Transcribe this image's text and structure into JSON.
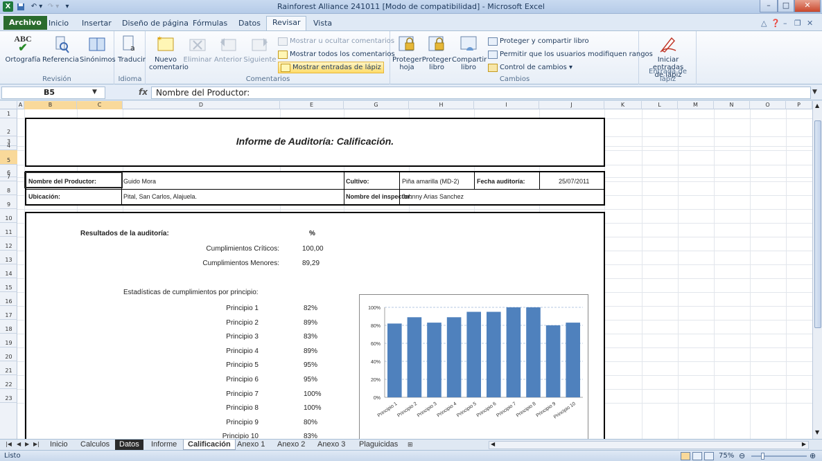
{
  "window": {
    "title": "Rainforest Alliance 241011  [Modo de compatibilidad]  -  Microsoft Excel",
    "app_icon": "X"
  },
  "menu": {
    "tabs": [
      "Archivo",
      "Inicio",
      "Insertar",
      "Diseño de página",
      "Fórmulas",
      "Datos",
      "Revisar",
      "Vista"
    ],
    "active": "Revisar"
  },
  "ribbon": {
    "revision": {
      "label": "Revisión",
      "ortografia": "Ortografía",
      "referencia": "Referencia",
      "sinonimos": "Sinónimos",
      "abc": "ABC"
    },
    "idioma": {
      "label": "Idioma",
      "traducir": "Traducir"
    },
    "comentarios": {
      "label": "Comentarios",
      "nuevo_1": "Nuevo",
      "nuevo_2": "comentario",
      "eliminar": "Eliminar",
      "anterior": "Anterior",
      "siguiente": "Siguiente",
      "mostrar_ocultar": "Mostrar u ocultar comentarios",
      "mostrar_todos": "Mostrar todos los comentarios",
      "mostrar_lapiz": "Mostrar entradas de lápiz"
    },
    "cambios": {
      "label": "Cambios",
      "proteger_hoja_1": "Proteger",
      "proteger_hoja_2": "hoja",
      "proteger_libro_1": "Proteger",
      "proteger_libro_2": "libro",
      "compartir_1": "Compartir",
      "compartir_2": "libro",
      "proteger_compartir": "Proteger y compartir libro",
      "permitir": "Permitir que los usuarios modifiquen rangos",
      "control": "Control de cambios ▾"
    },
    "lapiz": {
      "label": "Entrada de lápiz",
      "iniciar_1": "Iniciar entradas",
      "iniciar_2": "de lápiz"
    }
  },
  "formula_bar": {
    "name_box": "B5",
    "fx": "fx",
    "formula": "Nombre del Productor:"
  },
  "columns": [
    "A",
    "B",
    "C",
    "D",
    "E",
    "G",
    "H",
    "I",
    "J",
    "K",
    "L",
    "M",
    "N",
    "O",
    "P"
  ],
  "rows": [
    "1",
    "2",
    "3",
    "4",
    "5",
    "6",
    "7",
    "8",
    "9",
    "10",
    "11",
    "12",
    "13",
    "14",
    "15",
    "16",
    "17",
    "18",
    "19",
    "20",
    "21",
    "22",
    "23"
  ],
  "sheet": {
    "report_title": "Informe de Auditoría: Calificación.",
    "info": {
      "productor_label": "Nombre del Productor:",
      "productor_value": "Guido Mora",
      "cultivo_label": "Cultivo:",
      "cultivo_value": "Piña amarilla (MD-2)",
      "fecha_label": "Fecha auditoría:",
      "fecha_value": "25/07/2011",
      "ubicacion_label": "Ubicación:",
      "ubicacion_value": "Pital, San Carlos, Alajuela.",
      "inspector_label": "Nombre del inspector:",
      "inspector_value": "Johnny Arias Sanchez"
    },
    "results": {
      "heading": "Resultados de la auditoría:",
      "percent_header": "%",
      "criticos_label": "Cumplimientos Críticos:",
      "criticos_value": "100,00",
      "menores_label": "Cumplimientos Menores:",
      "menores_value": "89,29",
      "stats_heading": "Estadísticas de cumplimientos por principio:"
    },
    "principles": [
      {
        "label": "Principio 1",
        "value": "82%"
      },
      {
        "label": "Principio 2",
        "value": "89%"
      },
      {
        "label": "Principio 3",
        "value": "83%"
      },
      {
        "label": "Principio 4",
        "value": "89%"
      },
      {
        "label": "Principio 5",
        "value": "95%"
      },
      {
        "label": "Principio 6",
        "value": "95%"
      },
      {
        "label": "Principio 7",
        "value": "100%"
      },
      {
        "label": "Principio 8",
        "value": "100%"
      },
      {
        "label": "Principio 9",
        "value": "80%"
      },
      {
        "label": "Principio 10",
        "value": "83%"
      }
    ]
  },
  "chart_data": {
    "type": "bar",
    "categories": [
      "Principio 1",
      "Principio 2",
      "Principio 3",
      "Principio 4",
      "Principio 5",
      "Principio 6",
      "Principio 7",
      "Principio 8",
      "Principio 9",
      "Principio 10"
    ],
    "values": [
      82,
      89,
      83,
      89,
      95,
      95,
      100,
      100,
      80,
      83
    ],
    "yticks": [
      "0%",
      "20%",
      "40%",
      "60%",
      "80%",
      "100%"
    ],
    "ylim": [
      0,
      100
    ],
    "bar_color": "#4f81bd",
    "grid": true
  },
  "sheet_tabs": [
    "Inicio",
    "Calculos",
    "Datos",
    "Informe",
    "Calificación",
    "Anexo 1",
    "Anexo 2",
    "Anexo 3",
    "Plaguicidas"
  ],
  "active_sheet": "Calificación",
  "status": {
    "ready": "Listo",
    "zoom": "75%"
  }
}
